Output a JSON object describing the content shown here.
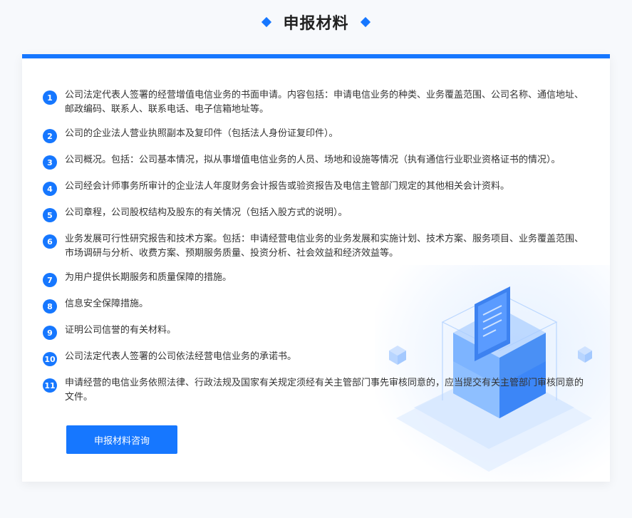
{
  "header": {
    "title": "申报材料"
  },
  "items": [
    {
      "num": "1",
      "text": "公司法定代表人签署的经营增值电信业务的书面申请。内容包括：申请电信业务的种类、业务覆盖范围、公司名称、通信地址、邮政编码、联系人、联系电话、电子信箱地址等。"
    },
    {
      "num": "2",
      "text": "公司的企业法人营业执照副本及复印件（包括法人身份证复印件）。"
    },
    {
      "num": "3",
      "text": "公司概况。包括：公司基本情况，拟从事增值电信业务的人员、场地和设施等情况（执有通信行业职业资格证书的情况）。"
    },
    {
      "num": "4",
      "text": "公司经会计师事务所审计的企业法人年度财务会计报告或验资报告及电信主管部门规定的其他相关会计资料。"
    },
    {
      "num": "5",
      "text": "公司章程，公司股权结构及股东的有关情况（包括入股方式的说明）。"
    },
    {
      "num": "6",
      "text": "业务发展可行性研究报告和技术方案。包括：申请经营电信业务的业务发展和实施计划、技术方案、服务项目、业务覆盖范围、市场调研与分析、收费方案、预期服务质量、投资分析、社会效益和经济效益等。"
    },
    {
      "num": "7",
      "text": "为用户提供长期服务和质量保障的措施。"
    },
    {
      "num": "8",
      "text": "信息安全保障措施。"
    },
    {
      "num": "9",
      "text": "证明公司信誉的有关材料。"
    },
    {
      "num": "10",
      "text": "公司法定代表人签署的公司依法经营电信业务的承诺书。"
    },
    {
      "num": "11",
      "text": "申请经营的电信业务依照法律、行政法规及国家有关规定须经有关主管部门事先审核同意的，应当提交有关主管部门审核同意的文件。"
    }
  ],
  "button": {
    "label": "申报材料咨询"
  },
  "colors": {
    "accent": "#1677ff"
  },
  "illustration": {
    "icon": "document-box-icon"
  }
}
